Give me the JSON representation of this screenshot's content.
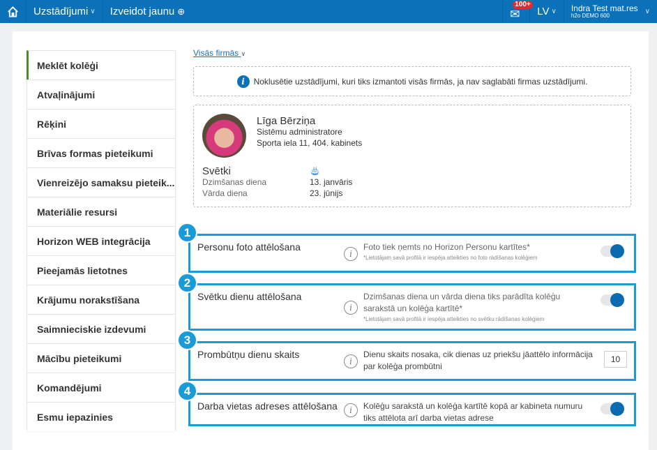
{
  "topbar": {
    "settings": "Uzstādījumi",
    "create": "Izveidot jaunu",
    "mail_badge": "100+",
    "lang": "LV",
    "user_name": "Indra Test mat.res",
    "company": "h2o DEMO 600"
  },
  "sidebar": {
    "items": [
      {
        "label": "Meklēt kolēģi"
      },
      {
        "label": "Atvaļinājumi"
      },
      {
        "label": "Rēķini"
      },
      {
        "label": "Brīvas formas pieteikumi"
      },
      {
        "label": "Vienreizējo samaksu pieteik..."
      },
      {
        "label": "Materiālie resursi"
      },
      {
        "label": "Horizon WEB integrācija"
      },
      {
        "label": "Pieejamās lietotnes"
      },
      {
        "label": "Krājumu norakstīšana"
      },
      {
        "label": "Saimnieciskie izdevumi"
      },
      {
        "label": "Mācību pieteikumi"
      },
      {
        "label": "Komandējumi"
      },
      {
        "label": "Esmu iepazinies"
      }
    ]
  },
  "main": {
    "company_filter": "Visās firmās",
    "info": "Noklusētie uzstādījumi, kuri tiks izmantoti visās firmās, ja nav saglabāti firmas uzstādījumi.",
    "profile": {
      "name": "Līga Bērziņa",
      "role": "Sistēmu administratore",
      "address": "Sporta iela 11, 404. kabinets",
      "holidays": "Svētki",
      "birthday_label": "Dzimšanas diena",
      "birthday": "13. janvāris",
      "nameday_label": "Vārda diena",
      "nameday": "23. jūnijs"
    },
    "settings": [
      {
        "num": "1",
        "title": "Personu foto attēlošana",
        "desc": "Foto tiek ņemts no Horizon Personu kartītes*",
        "note": "*Lietotājam savā profilā ir iespēja atteikties no foto rādīšanas kolēģiem",
        "enabled": true
      },
      {
        "num": "2",
        "title": "Svētku dienu attēlošana",
        "desc": "Dzimšanas diena un vārda diena tiks parādīta kolēģu sarakstā un kolēģa kartītē*",
        "note": "*Lietotājam savā profilā ir iespēja atteikties no svētku rādīšanas kolēģiem",
        "enabled": true
      },
      {
        "num": "3",
        "title": "Prombūtņu dienu skaits",
        "desc": "Dienu skaits nosaka, cik dienas uz priekšu jāattēlo informācija par kolēģa prombūtni",
        "value": "10"
      },
      {
        "num": "4",
        "title": "Darba vietas adreses attēlošana",
        "desc": "Kolēģu sarakstā un kolēģa kartītē kopā ar kabineta numuru tiks attēlota arī darba vietas adrese",
        "enabled": true
      }
    ]
  }
}
